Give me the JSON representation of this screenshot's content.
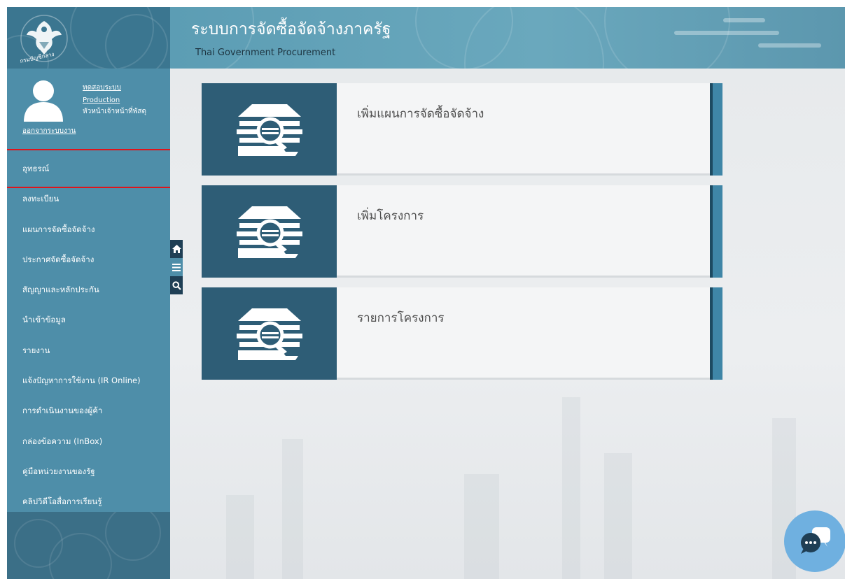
{
  "header": {
    "title": "ระบบการจัดซื้อจัดจ้างภาครัฐ",
    "subtitle": "Thai Government Procurement"
  },
  "user": {
    "name": "ทดสอบระบบ",
    "environment": "Production",
    "position": "หัวหน้าเจ้าหน้าที่พัสดุ",
    "logout": "ออกจากระบบงาน"
  },
  "sidebar": {
    "logo_text": "กรมบัญชีกลาง",
    "items": [
      {
        "label": "อุทธรณ์",
        "selected": true
      },
      {
        "label": "ลงทะเบียน"
      },
      {
        "label": "แผนการจัดซื้อจัดจ้าง"
      },
      {
        "label": "ประกาศจัดซื้อจัดจ้าง"
      },
      {
        "label": "สัญญาและหลักประกัน"
      },
      {
        "label": "นำเข้าข้อมูล"
      },
      {
        "label": "รายงาน"
      },
      {
        "label": "แจ้งปัญหาการใช้งาน (IR Online)"
      },
      {
        "label": "การดำเนินงานของผู้ค้า"
      },
      {
        "label": "กล่องข้อความ (InBox)"
      },
      {
        "label": "คู่มือหน่วยงานของรัฐ"
      },
      {
        "label": "คลิปวิดีโอสื่อการเรียนรู้"
      }
    ]
  },
  "toolbar": {
    "icons": [
      "home-icon",
      "menu-icon",
      "search-icon"
    ]
  },
  "cards": [
    {
      "label": "เพิ่มแผนการจัดซื้อจัดจ้าง",
      "icon": "procurement-icon"
    },
    {
      "label": "เพิ่มโครงการ",
      "icon": "procurement-icon"
    },
    {
      "label": "รายการโครงการ",
      "icon": "procurement-icon"
    }
  ],
  "colors": {
    "sidebar": "#4e8ea9",
    "header": "#6aa8bd",
    "card_icon_bg": "#2e5d76",
    "highlight": "#e0141b",
    "chat": "#6fb0e0"
  }
}
